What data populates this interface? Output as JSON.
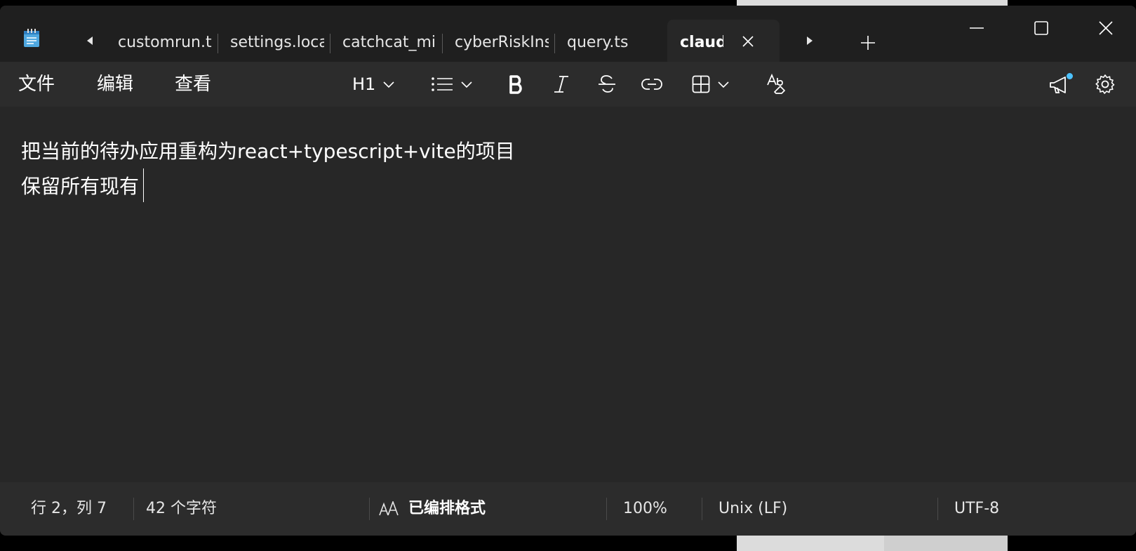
{
  "tabs": [
    {
      "label": "customrun.txt"
    },
    {
      "label": "settings.local"
    },
    {
      "label": "catchcat_mini"
    },
    {
      "label": "cyberRiskInst"
    },
    {
      "label": "query.ts"
    }
  ],
  "active_tab": {
    "label": "claude"
  },
  "menu": {
    "file": "文件",
    "edit": "编辑",
    "view": "查看"
  },
  "format": {
    "heading_label": "H1"
  },
  "editor": {
    "lines": [
      "把当前的待办应用重构为react+typescript+vite的项目",
      "保留所有现有"
    ]
  },
  "status": {
    "position": "行 2，列 7",
    "char_count": "42 个字符",
    "format_mode": "已编排格式",
    "zoom": "100%",
    "line_ending": "Unix (LF)",
    "encoding": "UTF-8"
  },
  "colors": {
    "accent_dot": "#4cc2ff",
    "window_bg": "#272727",
    "titlebar_bg": "#1f1f1f"
  },
  "icons": [
    "notepad-icon",
    "chevron-left-icon",
    "chevron-right-icon",
    "close-icon",
    "plus-icon",
    "minimize-icon",
    "maximize-icon",
    "chevron-down-icon",
    "list-icon",
    "bold-icon",
    "italic-icon",
    "strikethrough-icon",
    "link-icon",
    "table-icon",
    "clear-format-icon",
    "megaphone-icon",
    "gear-icon",
    "text-format-icon"
  ]
}
